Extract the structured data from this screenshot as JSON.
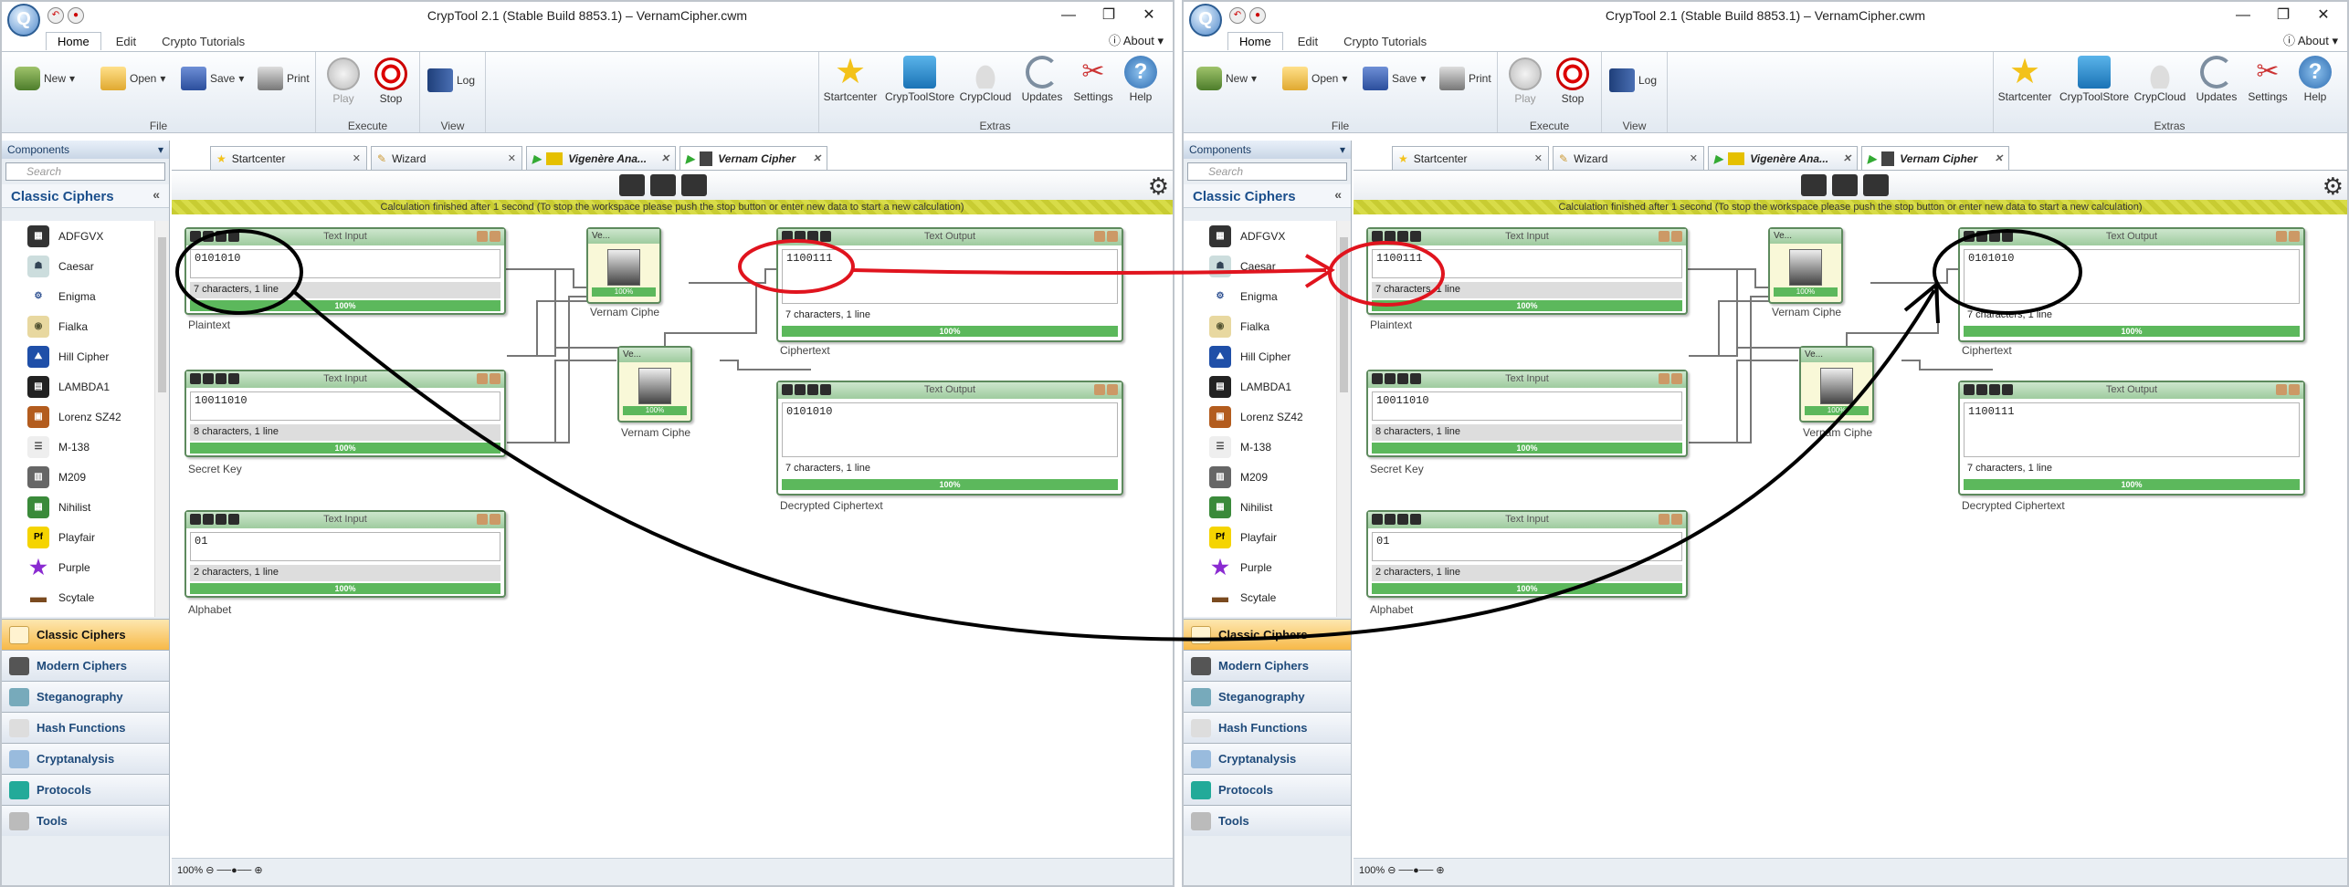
{
  "app": {
    "title": "CrypTool 2.1 (Stable Build 8853.1) – VernamCipher.cwm",
    "menu_tabs": [
      "Home",
      "Edit",
      "Crypto Tutorials"
    ],
    "about": "About",
    "ribbon": {
      "new": "New",
      "open": "Open",
      "save": "Save",
      "print": "Print",
      "play": "Play",
      "stop": "Stop",
      "log": "Log",
      "startcenter": "Startcenter",
      "cryptoolstore": "CrypToolStore",
      "crypcloud": "CrypCloud",
      "updates": "Updates",
      "settings": "Settings",
      "help": "Help",
      "group_file": "File",
      "group_execute": "Execute",
      "group_view": "View",
      "group_extras": "Extras"
    }
  },
  "components": {
    "header": "Components",
    "search_placeholder": "Search",
    "category_title": "Classic Ciphers",
    "items": [
      "ADFGVX",
      "Caesar",
      "Enigma",
      "Fialka",
      "Hill Cipher",
      "LAMBDA1",
      "Lorenz SZ42",
      "M-138",
      "M209",
      "Nihilist",
      "Playfair",
      "Purple",
      "Scytale"
    ],
    "categories": [
      "Classic Ciphers",
      "Modern Ciphers",
      "Steganography",
      "Hash Functions",
      "Cryptanalysis",
      "Protocols",
      "Tools"
    ]
  },
  "editor": {
    "tabs": [
      "Startcenter",
      "Wizard",
      "Vigenère Ana...",
      "Vernam Cipher"
    ],
    "banner": "Calculation finished after 1 second (To stop the workspace please push the stop button or enter new data to start a new calculation)",
    "zoom": "100%"
  },
  "left_window": {
    "plaintext": {
      "header": "Text Input",
      "value": "0101010",
      "info": "7 characters,  1 line",
      "progress": "100%",
      "label": "Plaintext"
    },
    "secret_key": {
      "header": "Text Input",
      "value": "10011010",
      "info": "8 characters,  1 line",
      "progress": "100%",
      "label": "Secret Key"
    },
    "alphabet": {
      "header": "Text Input",
      "value": "01",
      "info": "2 characters,  1 line",
      "progress": "100%",
      "label": "Alphabet"
    },
    "vernam1": {
      "header": "Ve...",
      "progress": "100%",
      "label": "Vernam Ciphe"
    },
    "vernam2": {
      "header": "Ve...",
      "progress": "100%",
      "label": "Vernam Ciphe"
    },
    "ciphertext": {
      "header": "Text Output",
      "value": "1100111",
      "info": "7 characters,  1 line",
      "progress": "100%",
      "label": "Ciphertext"
    },
    "decrypted": {
      "header": "Text Output",
      "value": "0101010",
      "info": "7 characters,  1 line",
      "progress": "100%",
      "label": "Decrypted Ciphertext"
    }
  },
  "right_window": {
    "plaintext": {
      "header": "Text Input",
      "value": "1100111",
      "info": "7 characters,  1 line",
      "progress": "100%",
      "label": "Plaintext"
    },
    "secret_key": {
      "header": "Text Input",
      "value": "10011010",
      "info": "8 characters,  1 line",
      "progress": "100%",
      "label": "Secret Key"
    },
    "alphabet": {
      "header": "Text Input",
      "value": "01",
      "info": "2 characters,  1 line",
      "progress": "100%",
      "label": "Alphabet"
    },
    "vernam1": {
      "header": "Ve...",
      "progress": "100%",
      "label": "Vernam Ciphe"
    },
    "vernam2": {
      "header": "Ve...",
      "progress": "100%",
      "label": "Vernam Ciphe"
    },
    "ciphertext": {
      "header": "Text Output",
      "value": "0101010",
      "info": "7 characters,  1 line",
      "progress": "100%",
      "label": "Ciphertext"
    },
    "decrypted": {
      "header": "Text Output",
      "value": "1100111",
      "info": "7 characters,  1 line",
      "progress": "100%",
      "label": "Decrypted Ciphertext"
    }
  },
  "colors": {
    "accent": "#2c5d93",
    "progress": "#5cb85c",
    "plugin_border": "#5d8a5d",
    "annotation_red": "#e0141e",
    "annotation_black": "#000000"
  }
}
